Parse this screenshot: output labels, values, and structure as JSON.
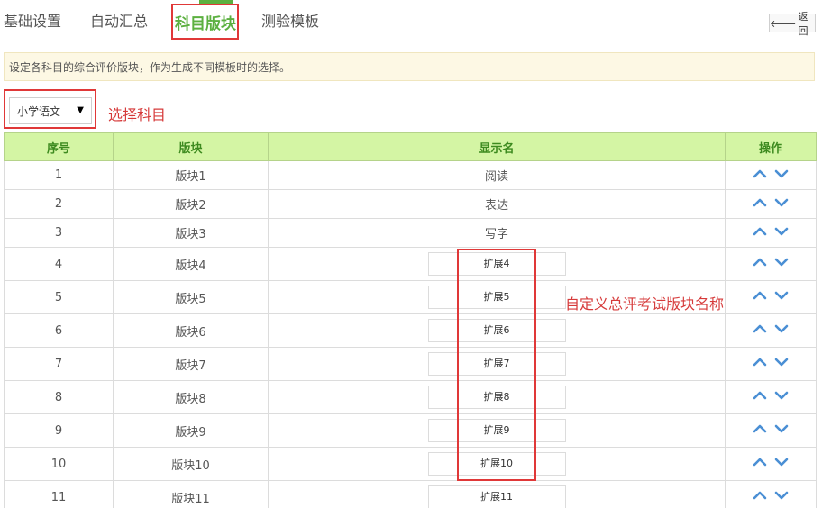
{
  "tabs": [
    {
      "label": "基础设置",
      "active": false
    },
    {
      "label": "自动汇总",
      "active": false
    },
    {
      "label": "科目版块",
      "active": true
    },
    {
      "label": "测验模板",
      "active": false
    }
  ],
  "back_button": {
    "icon": "arrow-left-icon",
    "label": "返回"
  },
  "notice": "设定各科目的综合评价版块，作为生成不同模板时的选择。",
  "subject_select": {
    "value": "小学语文"
  },
  "annotations": {
    "select_hint": "选择科目",
    "custom_name_hint": "自定义总评考试版块名称"
  },
  "table": {
    "headers": [
      "序号",
      "版块",
      "显示名",
      "操作"
    ],
    "rows": [
      {
        "no": "1",
        "block": "版块1",
        "display": "阅读",
        "editable": false
      },
      {
        "no": "2",
        "block": "版块2",
        "display": "表达",
        "editable": false
      },
      {
        "no": "3",
        "block": "版块3",
        "display": "写字",
        "editable": false
      },
      {
        "no": "4",
        "block": "版块4",
        "display": "扩展4",
        "editable": true
      },
      {
        "no": "5",
        "block": "版块5",
        "display": "扩展5",
        "editable": true
      },
      {
        "no": "6",
        "block": "版块6",
        "display": "扩展6",
        "editable": true
      },
      {
        "no": "7",
        "block": "版块7",
        "display": "扩展7",
        "editable": true
      },
      {
        "no": "8",
        "block": "版块8",
        "display": "扩展8",
        "editable": true
      },
      {
        "no": "9",
        "block": "版块9",
        "display": "扩展9",
        "editable": true
      },
      {
        "no": "10",
        "block": "版块10",
        "display": "扩展10",
        "editable": true
      },
      {
        "no": "11",
        "block": "版块11",
        "display": "扩展11",
        "editable": true
      }
    ],
    "op_icons": [
      "chevron-up-icon",
      "chevron-down-icon"
    ]
  },
  "colors": {
    "accent": "#5cb040",
    "header_bg": "#d4f5a4",
    "header_text": "#3d8a1f",
    "annotation": "#d63a3a",
    "icon_blue": "#4a8fd4",
    "notice_bg": "#fdf8e4"
  }
}
